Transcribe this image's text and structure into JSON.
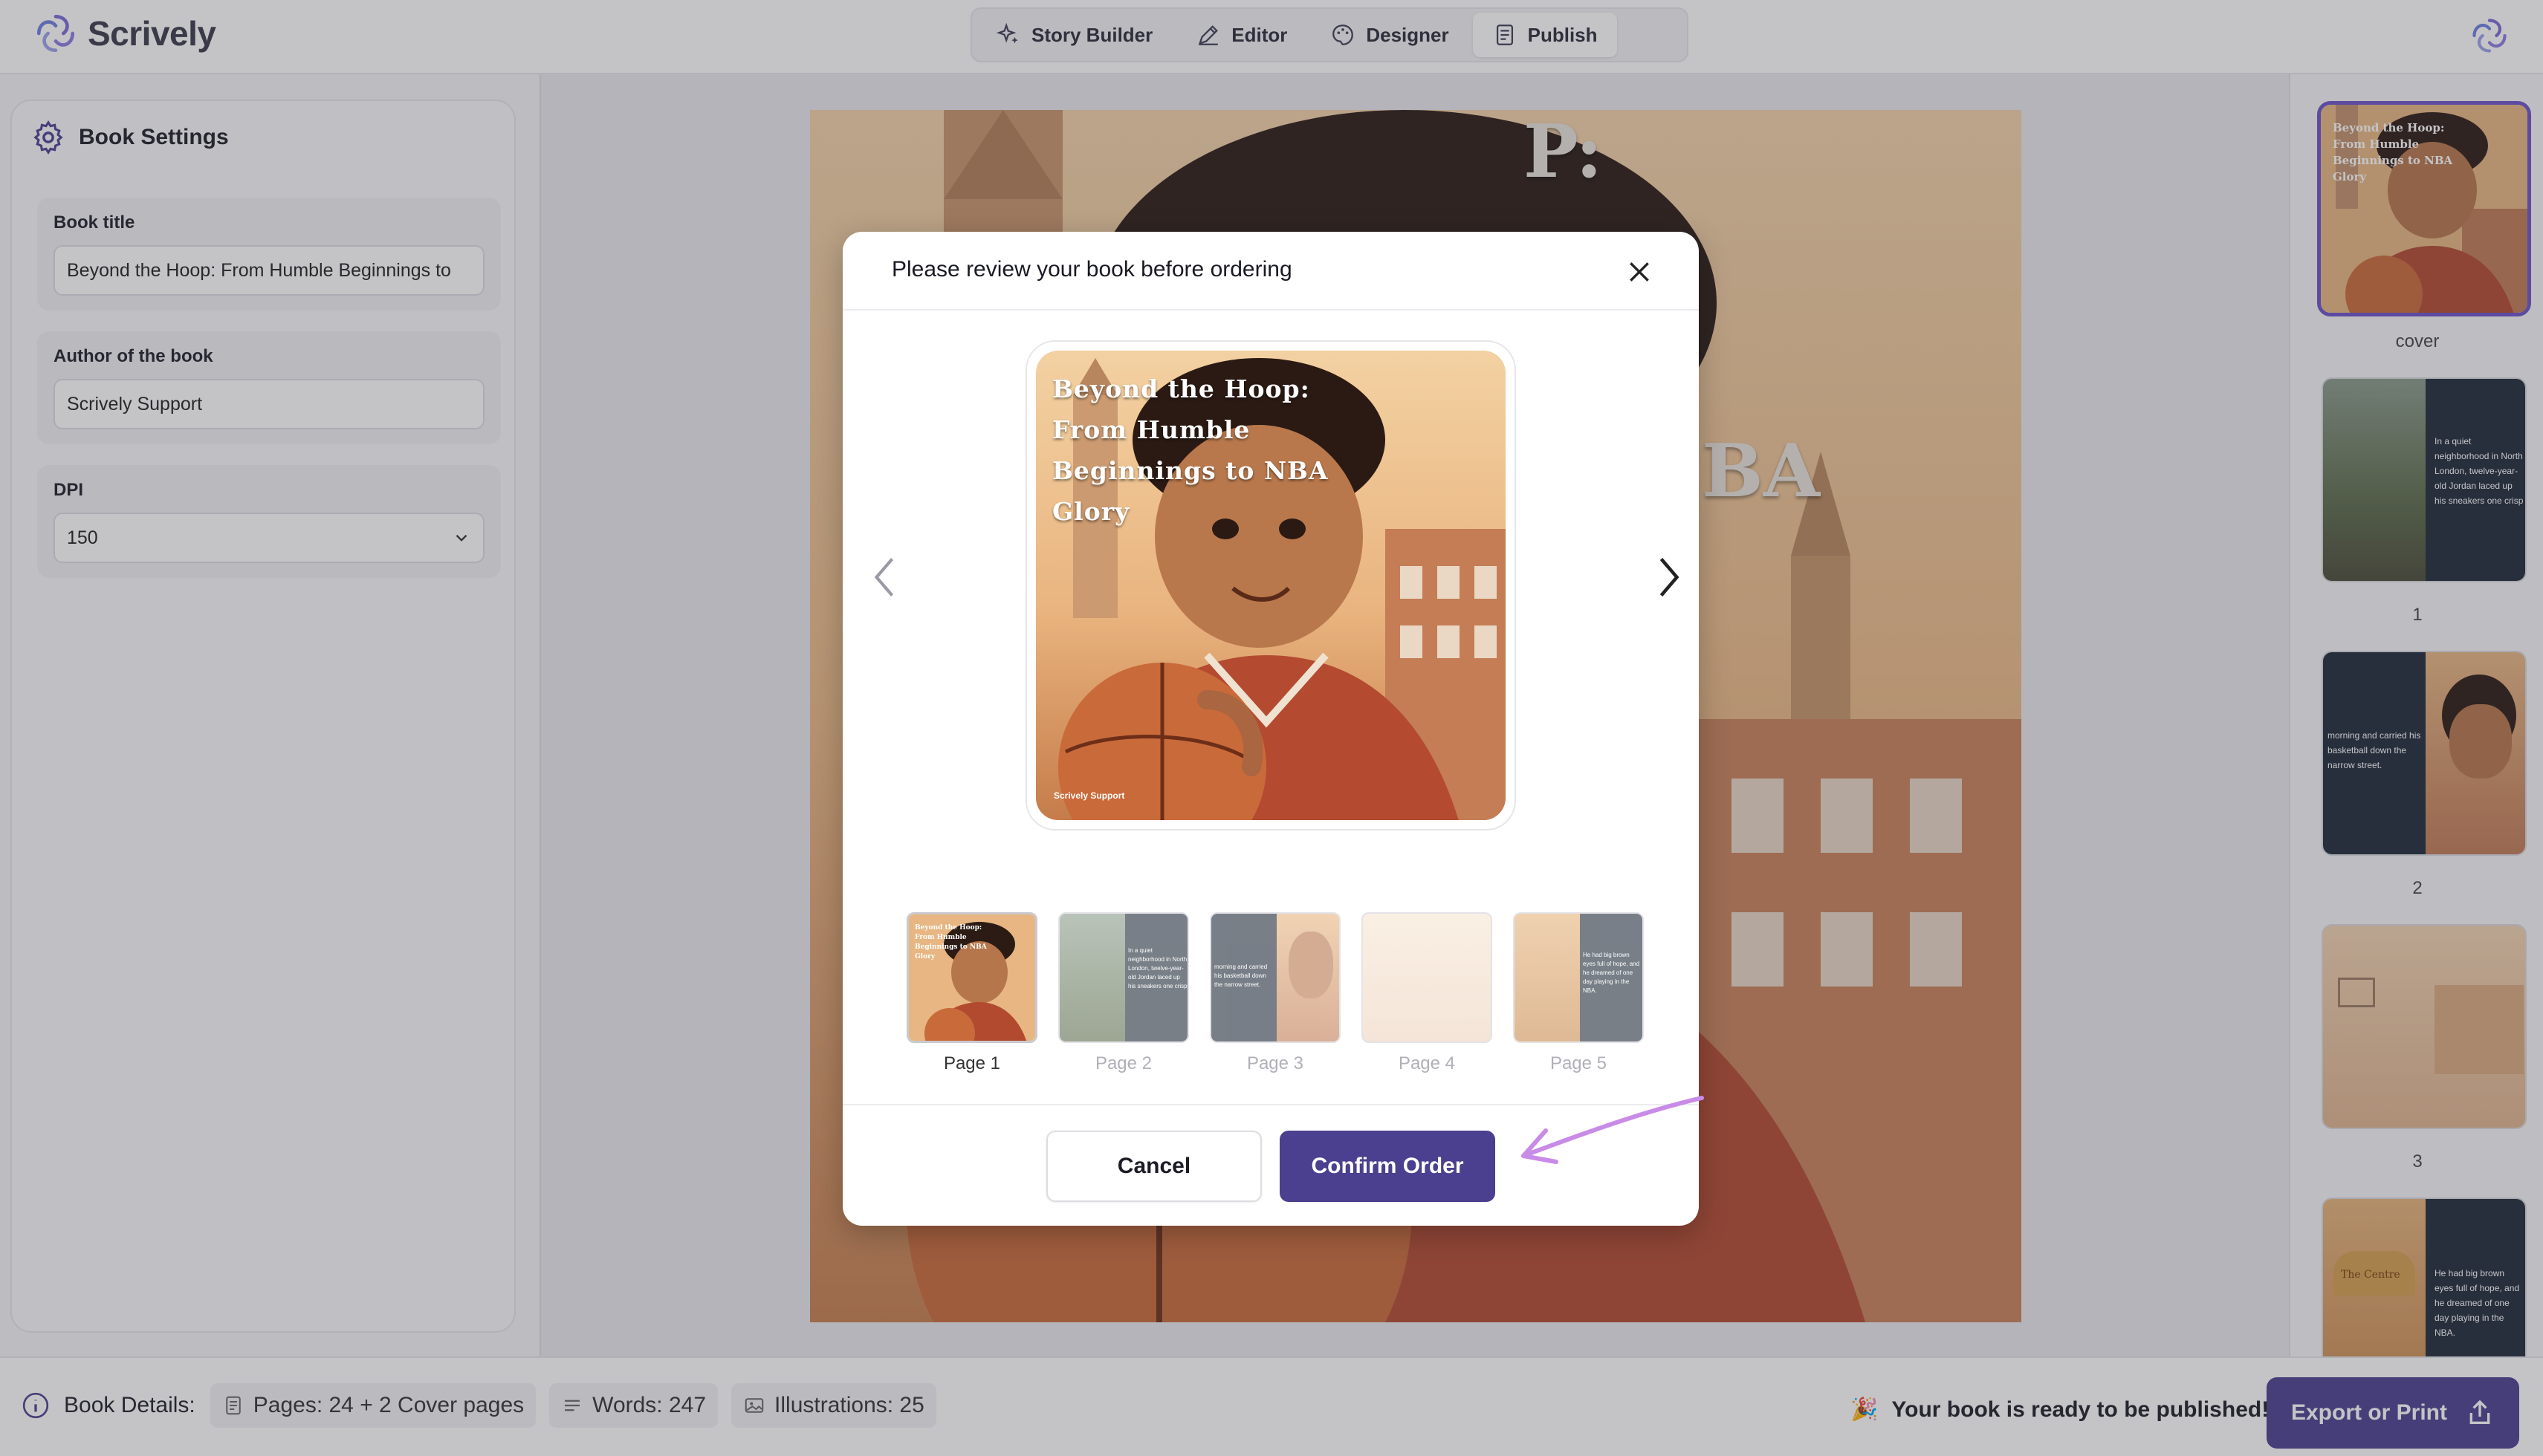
{
  "app": {
    "name": "Scrively"
  },
  "nav": {
    "tabs": [
      {
        "label": "Story Builder",
        "icon": "sparkle-icon"
      },
      {
        "label": "Editor",
        "icon": "pen-icon"
      },
      {
        "label": "Designer",
        "icon": "palette-icon"
      },
      {
        "label": "Publish",
        "icon": "document-icon",
        "active": true
      }
    ]
  },
  "settings": {
    "title": "Book Settings",
    "book_title_label": "Book title",
    "book_title_value": "Beyond the Hoop: From Humble Beginnings to",
    "author_label": "Author of the book",
    "author_value": "Scrively Support",
    "dpi_label": "DPI",
    "dpi_value": "150"
  },
  "book": {
    "cover_title_lines": [
      "Beyond the Hoop:",
      "From Humble",
      "Beginnings to NBA",
      "Glory"
    ],
    "big_cover_fragments": [
      "P:",
      "BA"
    ],
    "author": "Scrively Support"
  },
  "right_thumbs": [
    {
      "label": "cover"
    },
    {
      "label": "1",
      "text": "In a quiet neighborhood in North London, twelve-year-old Jordan laced up his sneakers one crisp"
    },
    {
      "label": "2",
      "text": "morning and carried his basketball down the narrow street."
    },
    {
      "label": "3"
    },
    {
      "label": "",
      "text": "He had big brown eyes full of hope, and he dreamed of one day playing in the NBA.",
      "sign": "The Centre"
    }
  ],
  "modal": {
    "title": "Please review your book before ordering",
    "pages": [
      {
        "label": "Page 1",
        "active": true
      },
      {
        "label": "Page 2"
      },
      {
        "label": "Page 3"
      },
      {
        "label": "Page 4"
      },
      {
        "label": "Page 5"
      }
    ],
    "cancel_label": "Cancel",
    "confirm_label": "Confirm Order"
  },
  "details": {
    "label": "Book Details:",
    "pages": "Pages: 24 + 2 Cover pages",
    "words": "Words: 247",
    "illustrations": "Illustrations: 25"
  },
  "status": {
    "ready_text": "Your book is ready to be published!",
    "ready_emoji": "🎉",
    "export_label": "Export or Print"
  },
  "colors": {
    "accent": "#4b3f8f",
    "selection": "#6a52c8",
    "annotation": "#c98be8"
  }
}
